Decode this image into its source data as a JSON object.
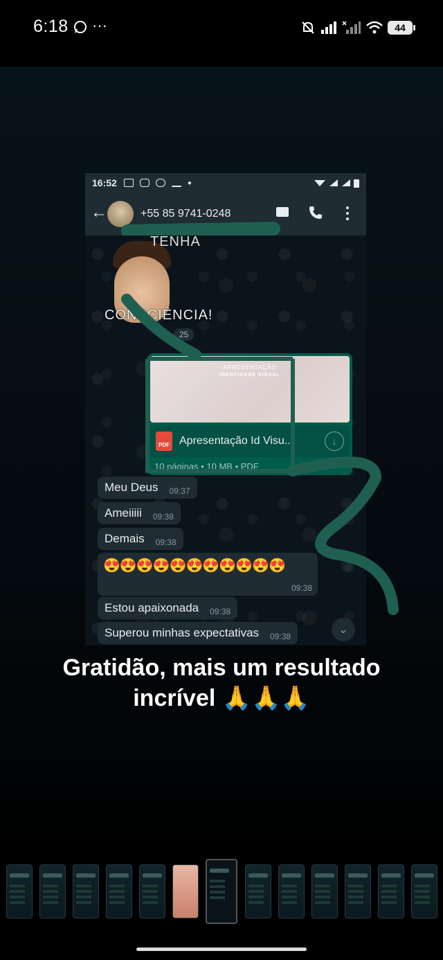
{
  "status_bar": {
    "time": "6:18",
    "dots": "···",
    "battery": "44"
  },
  "inner_screenshot": {
    "status_time": "16:52",
    "header": {
      "contact_name": "+55 85 9741-0248"
    },
    "sticker": {
      "text_top": "TENHA",
      "text_bottom": "CONSCIÊNCIA!",
      "time": "25"
    },
    "document": {
      "thumb_title": "APRESENTAÇÃO",
      "thumb_subtitle": "IDENTIDADE VISUAL",
      "pdf_label": "PDF",
      "file_name": "Apresentação Id Visu...",
      "meta": "10 páginas • 10 MB • PDF"
    },
    "messages": [
      {
        "text": "Meu Deus",
        "time": "09:37"
      },
      {
        "text": "Ameiiiii",
        "time": "09:38"
      },
      {
        "text": "Demais",
        "time": "09:38"
      },
      {
        "text": "😍😍😍😍😍😍😍😍😍😍😍",
        "time": "09:38"
      },
      {
        "text": "Estou apaixonada",
        "time": "09:38"
      },
      {
        "text": "Superou minhas expectativas",
        "time": "09:38"
      }
    ]
  },
  "caption": {
    "line1": "Gratidão, mais um resultado",
    "line2": "incrível 🙏🙏🙏"
  },
  "colors": {
    "scribble": "#1f5f52",
    "outgoing_bubble": "#005c4b",
    "incoming_bubble": "#202c33"
  }
}
